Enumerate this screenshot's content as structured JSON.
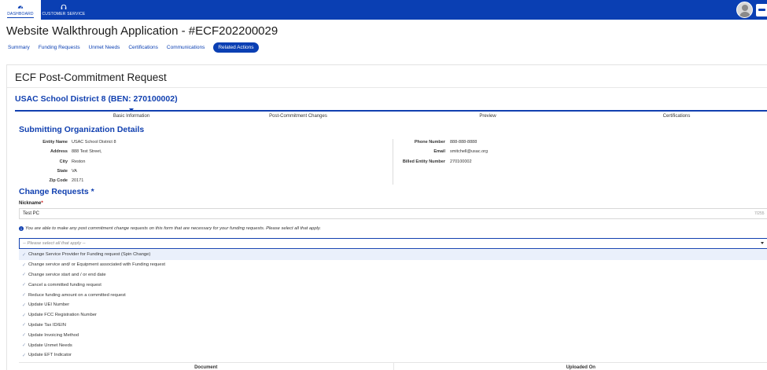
{
  "topnav": {
    "dashboard_label": "DASHBOARD",
    "customer_service_label": "CUSTOMER SERVICE"
  },
  "app": {
    "title": "Website Walkthrough Application - #ECF202200029"
  },
  "tabs": [
    {
      "label": "Summary"
    },
    {
      "label": "Funding Requests"
    },
    {
      "label": "Unmet Needs"
    },
    {
      "label": "Certifications"
    },
    {
      "label": "Communications"
    },
    {
      "label": "Related Actions",
      "active": true
    }
  ],
  "card": {
    "title": "ECF Post-Commitment Request",
    "entity_heading": "USAC School District 8 (BEN: 270100002)"
  },
  "steps": [
    {
      "label": "Basic Information"
    },
    {
      "label": "Post-Commitment Changes"
    },
    {
      "label": "Preview"
    },
    {
      "label": "Certifications"
    }
  ],
  "org": {
    "heading": "Submitting Organization Details",
    "left": [
      {
        "label": "Entity Name",
        "value": "USAC School District 8"
      },
      {
        "label": "Address",
        "value": "888 Test Street,"
      },
      {
        "label": "City",
        "value": "Reston"
      },
      {
        "label": "State",
        "value": "VA"
      },
      {
        "label": "Zip Code",
        "value": "20171"
      }
    ],
    "right": [
      {
        "label": "Phone Number",
        "value": "888-888-8888"
      },
      {
        "label": "Email",
        "value": "smitchell@usac.org"
      },
      {
        "label": "Billed Entity Number",
        "value": "270100002"
      }
    ]
  },
  "change_requests": {
    "heading": "Change Requests *",
    "nickname_label": "Nickname",
    "nickname_required_mark": "*",
    "nickname_value": "Test PC",
    "char_count": "7/255",
    "info_text": "You are able to make any post commitment change requests on this form that are necessary for your funding requests. Please select all that apply.",
    "select_placeholder": "-- Please select all that apply --",
    "options": [
      "Change Service Provider for Funding request (Spin Change)",
      "Change service and/ or Equipment associated with Funding request",
      "Change service start and / or end date",
      "Cancel a committed funding request",
      "Reduce funding amount on a committed request",
      "Update UEI Number",
      "Update FCC Registration Number",
      "Update Tax ID/EIN",
      "Update Invoicing Method",
      "Update Unmet Needs",
      "Update EFT Indicator"
    ]
  },
  "documents_table": {
    "columns": [
      "Document",
      "Uploaded On"
    ]
  },
  "colors": {
    "primary": "#0a3fb3",
    "heading_blue": "#1140b0"
  }
}
